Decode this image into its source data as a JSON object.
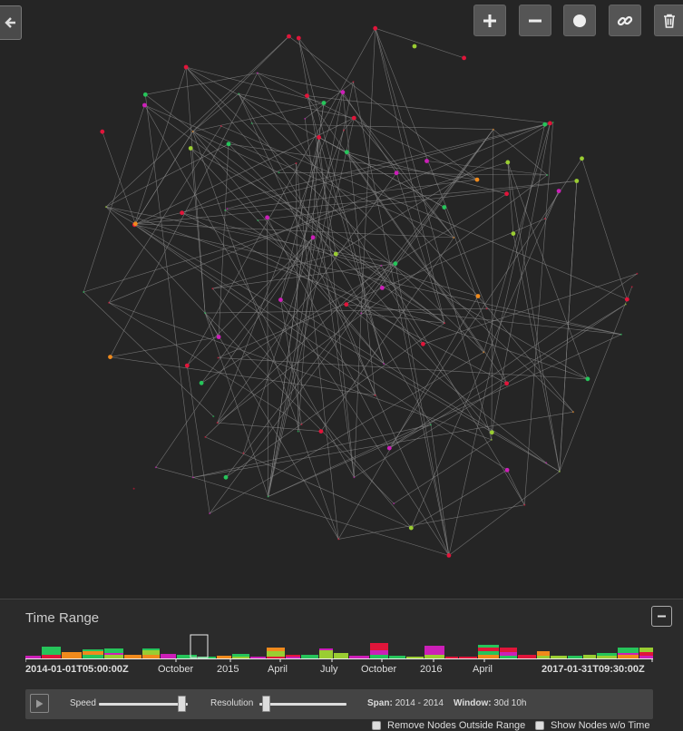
{
  "toolbar": {
    "back_icon": "arrow-left-icon",
    "buttons": [
      {
        "name": "zoom-in-button",
        "icon": "plus-icon"
      },
      {
        "name": "zoom-out-button",
        "icon": "minus-icon"
      },
      {
        "name": "fit-button",
        "icon": "circle-icon"
      },
      {
        "name": "link-button",
        "icon": "link-icon"
      },
      {
        "name": "delete-button",
        "icon": "trash-icon"
      }
    ]
  },
  "colors": {
    "background": "#252525",
    "edge": "#8a8a8a",
    "red": "#e0153a",
    "green": "#26c45a",
    "magenta": "#cc1fb8",
    "orange": "#f08a1c",
    "lime": "#9acd32"
  },
  "time_range": {
    "title": "Time Range",
    "axis_start": "2014-01-01T05:00:00Z",
    "axis_end": "2017-01-31T09:30:00Z",
    "ticks": [
      "October",
      "2015",
      "April",
      "July",
      "October",
      "2016",
      "April"
    ],
    "speed_label": "Speed",
    "resolution_label": "Resolution",
    "speed_level": 0.93,
    "resolution_level": 0.07,
    "span_label": "Span:",
    "span_value": "2014 - 2014",
    "window_label": "Window:",
    "window_value": "30d 10h",
    "remove_nodes_label": "Remove Nodes Outside Range",
    "show_nodes_label": "Show Nodes w/o Time"
  }
}
